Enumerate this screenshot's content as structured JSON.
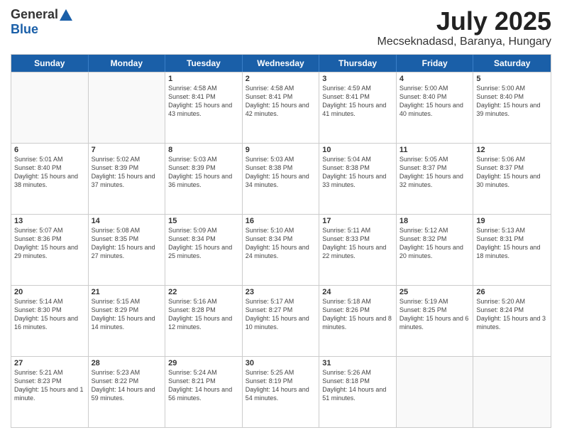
{
  "logo": {
    "general": "General",
    "blue": "Blue"
  },
  "header": {
    "month": "July 2025",
    "location": "Mecseknadasd, Baranya, Hungary"
  },
  "weekdays": [
    "Sunday",
    "Monday",
    "Tuesday",
    "Wednesday",
    "Thursday",
    "Friday",
    "Saturday"
  ],
  "weeks": [
    [
      {
        "day": "",
        "sunrise": "",
        "sunset": "",
        "daylight": ""
      },
      {
        "day": "",
        "sunrise": "",
        "sunset": "",
        "daylight": ""
      },
      {
        "day": "1",
        "sunrise": "Sunrise: 4:58 AM",
        "sunset": "Sunset: 8:41 PM",
        "daylight": "Daylight: 15 hours and 43 minutes."
      },
      {
        "day": "2",
        "sunrise": "Sunrise: 4:58 AM",
        "sunset": "Sunset: 8:41 PM",
        "daylight": "Daylight: 15 hours and 42 minutes."
      },
      {
        "day": "3",
        "sunrise": "Sunrise: 4:59 AM",
        "sunset": "Sunset: 8:41 PM",
        "daylight": "Daylight: 15 hours and 41 minutes."
      },
      {
        "day": "4",
        "sunrise": "Sunrise: 5:00 AM",
        "sunset": "Sunset: 8:40 PM",
        "daylight": "Daylight: 15 hours and 40 minutes."
      },
      {
        "day": "5",
        "sunrise": "Sunrise: 5:00 AM",
        "sunset": "Sunset: 8:40 PM",
        "daylight": "Daylight: 15 hours and 39 minutes."
      }
    ],
    [
      {
        "day": "6",
        "sunrise": "Sunrise: 5:01 AM",
        "sunset": "Sunset: 8:40 PM",
        "daylight": "Daylight: 15 hours and 38 minutes."
      },
      {
        "day": "7",
        "sunrise": "Sunrise: 5:02 AM",
        "sunset": "Sunset: 8:39 PM",
        "daylight": "Daylight: 15 hours and 37 minutes."
      },
      {
        "day": "8",
        "sunrise": "Sunrise: 5:03 AM",
        "sunset": "Sunset: 8:39 PM",
        "daylight": "Daylight: 15 hours and 36 minutes."
      },
      {
        "day": "9",
        "sunrise": "Sunrise: 5:03 AM",
        "sunset": "Sunset: 8:38 PM",
        "daylight": "Daylight: 15 hours and 34 minutes."
      },
      {
        "day": "10",
        "sunrise": "Sunrise: 5:04 AM",
        "sunset": "Sunset: 8:38 PM",
        "daylight": "Daylight: 15 hours and 33 minutes."
      },
      {
        "day": "11",
        "sunrise": "Sunrise: 5:05 AM",
        "sunset": "Sunset: 8:37 PM",
        "daylight": "Daylight: 15 hours and 32 minutes."
      },
      {
        "day": "12",
        "sunrise": "Sunrise: 5:06 AM",
        "sunset": "Sunset: 8:37 PM",
        "daylight": "Daylight: 15 hours and 30 minutes."
      }
    ],
    [
      {
        "day": "13",
        "sunrise": "Sunrise: 5:07 AM",
        "sunset": "Sunset: 8:36 PM",
        "daylight": "Daylight: 15 hours and 29 minutes."
      },
      {
        "day": "14",
        "sunrise": "Sunrise: 5:08 AM",
        "sunset": "Sunset: 8:35 PM",
        "daylight": "Daylight: 15 hours and 27 minutes."
      },
      {
        "day": "15",
        "sunrise": "Sunrise: 5:09 AM",
        "sunset": "Sunset: 8:34 PM",
        "daylight": "Daylight: 15 hours and 25 minutes."
      },
      {
        "day": "16",
        "sunrise": "Sunrise: 5:10 AM",
        "sunset": "Sunset: 8:34 PM",
        "daylight": "Daylight: 15 hours and 24 minutes."
      },
      {
        "day": "17",
        "sunrise": "Sunrise: 5:11 AM",
        "sunset": "Sunset: 8:33 PM",
        "daylight": "Daylight: 15 hours and 22 minutes."
      },
      {
        "day": "18",
        "sunrise": "Sunrise: 5:12 AM",
        "sunset": "Sunset: 8:32 PM",
        "daylight": "Daylight: 15 hours and 20 minutes."
      },
      {
        "day": "19",
        "sunrise": "Sunrise: 5:13 AM",
        "sunset": "Sunset: 8:31 PM",
        "daylight": "Daylight: 15 hours and 18 minutes."
      }
    ],
    [
      {
        "day": "20",
        "sunrise": "Sunrise: 5:14 AM",
        "sunset": "Sunset: 8:30 PM",
        "daylight": "Daylight: 15 hours and 16 minutes."
      },
      {
        "day": "21",
        "sunrise": "Sunrise: 5:15 AM",
        "sunset": "Sunset: 8:29 PM",
        "daylight": "Daylight: 15 hours and 14 minutes."
      },
      {
        "day": "22",
        "sunrise": "Sunrise: 5:16 AM",
        "sunset": "Sunset: 8:28 PM",
        "daylight": "Daylight: 15 hours and 12 minutes."
      },
      {
        "day": "23",
        "sunrise": "Sunrise: 5:17 AM",
        "sunset": "Sunset: 8:27 PM",
        "daylight": "Daylight: 15 hours and 10 minutes."
      },
      {
        "day": "24",
        "sunrise": "Sunrise: 5:18 AM",
        "sunset": "Sunset: 8:26 PM",
        "daylight": "Daylight: 15 hours and 8 minutes."
      },
      {
        "day": "25",
        "sunrise": "Sunrise: 5:19 AM",
        "sunset": "Sunset: 8:25 PM",
        "daylight": "Daylight: 15 hours and 6 minutes."
      },
      {
        "day": "26",
        "sunrise": "Sunrise: 5:20 AM",
        "sunset": "Sunset: 8:24 PM",
        "daylight": "Daylight: 15 hours and 3 minutes."
      }
    ],
    [
      {
        "day": "27",
        "sunrise": "Sunrise: 5:21 AM",
        "sunset": "Sunset: 8:23 PM",
        "daylight": "Daylight: 15 hours and 1 minute."
      },
      {
        "day": "28",
        "sunrise": "Sunrise: 5:23 AM",
        "sunset": "Sunset: 8:22 PM",
        "daylight": "Daylight: 14 hours and 59 minutes."
      },
      {
        "day": "29",
        "sunrise": "Sunrise: 5:24 AM",
        "sunset": "Sunset: 8:21 PM",
        "daylight": "Daylight: 14 hours and 56 minutes."
      },
      {
        "day": "30",
        "sunrise": "Sunrise: 5:25 AM",
        "sunset": "Sunset: 8:19 PM",
        "daylight": "Daylight: 14 hours and 54 minutes."
      },
      {
        "day": "31",
        "sunrise": "Sunrise: 5:26 AM",
        "sunset": "Sunset: 8:18 PM",
        "daylight": "Daylight: 14 hours and 51 minutes."
      },
      {
        "day": "",
        "sunrise": "",
        "sunset": "",
        "daylight": ""
      },
      {
        "day": "",
        "sunrise": "",
        "sunset": "",
        "daylight": ""
      }
    ]
  ]
}
